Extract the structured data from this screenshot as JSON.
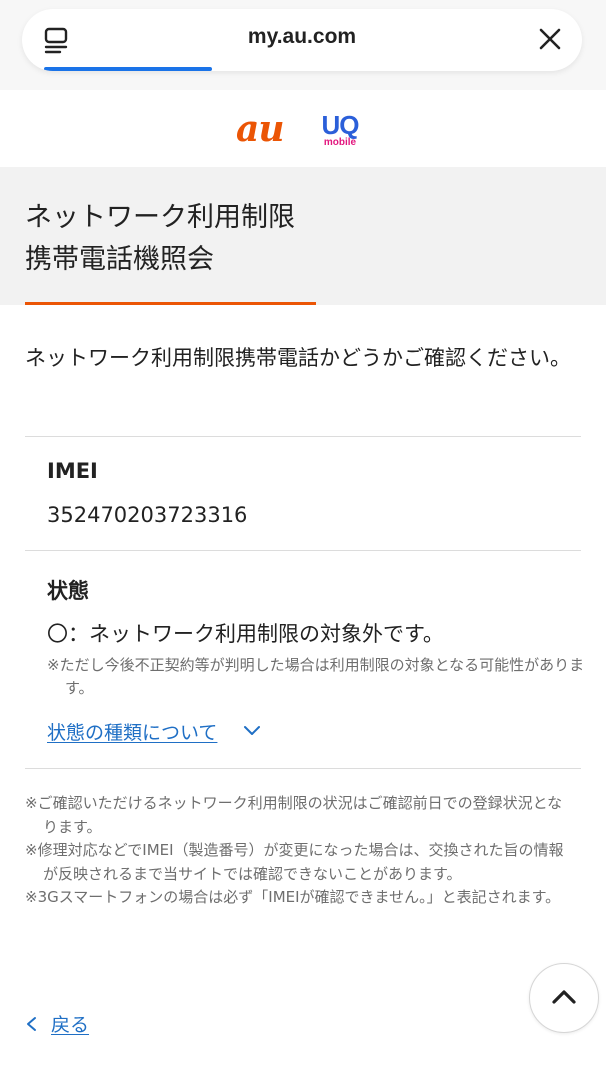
{
  "browser": {
    "url": "my.au.com",
    "progress_fraction": 0.3
  },
  "logos": {
    "au": "au",
    "uq_main": "UQ",
    "uq_sub": "mobile"
  },
  "page": {
    "title_line1": "ネットワーク利用制限",
    "title_line2": "携帯電話機照会",
    "intro": "ネットワーク利用制限携帯電話かどうかご確認ください。"
  },
  "imei": {
    "label": "IMEI",
    "value": "352470203723316"
  },
  "status": {
    "label": "状態",
    "value": "〇：ネットワーク利用制限の対象外です。",
    "note": "※ただし今後不正契約等が判明した場合は利用制限の対象となる可能性があります。",
    "link": "状態の種類について"
  },
  "footnotes": [
    "※ご確認いただけるネットワーク利用制限の状況はご確認前日での登録状況となります。",
    "※修理対応などでIMEI（製造番号）が変更になった場合は、交換された旨の情報が反映されるまで当サイトでは確認できないことがあります。",
    "※3Gスマートフォンの場合は必ず「IMEIが確認できません。」と表記されます。"
  ],
  "nav": {
    "back_label": "戻る"
  },
  "colors": {
    "au_orange": "#eb5505",
    "link_blue": "#1f6fc5",
    "uq_blue": "#2b5fd9",
    "uq_pink": "#e2177e"
  }
}
